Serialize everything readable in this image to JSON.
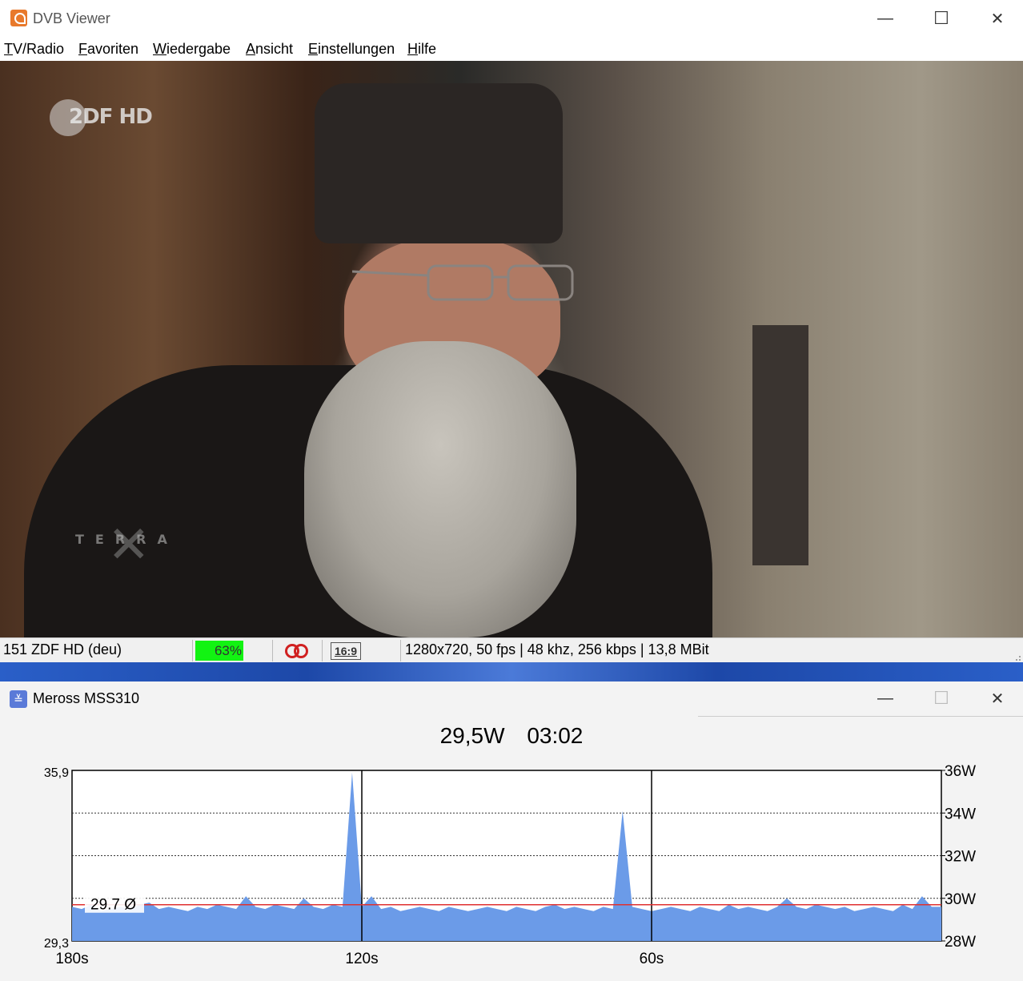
{
  "dvb_window": {
    "title": "DVB Viewer",
    "controls": {
      "minimize": "—",
      "maximize": "☐",
      "close": "✕"
    },
    "menu": [
      {
        "accel": "T",
        "rest": "V/Radio"
      },
      {
        "accel": "F",
        "rest": "avoriten"
      },
      {
        "accel": "W",
        "rest": "iedergabe"
      },
      {
        "accel": "A",
        "rest": "nsicht"
      },
      {
        "accel": "E",
        "rest": "instellungen"
      },
      {
        "accel": "H",
        "rest": "ilfe"
      }
    ],
    "video": {
      "channel_logo": "2DF HD",
      "watermark": "TERRA"
    },
    "status": {
      "channel": "151 ZDF HD (deu)",
      "signal_percent": 63,
      "signal_text": "63%",
      "aspect": "16:9",
      "stream_info": "1280x720, 50 fps | 48 khz, 256 kbps | 13,8 MBit",
      "signal_color": "#12f312"
    }
  },
  "meross_window": {
    "title": "Meross MSS310",
    "controls": {
      "minimize": "—",
      "maximize": "☐",
      "close": "✕"
    },
    "power": "29,5W",
    "elapsed": "03:02",
    "chart_data": {
      "type": "area",
      "x_labels": [
        "180s",
        "120s",
        "60s"
      ],
      "left_axis": {
        "max_label": "35,9",
        "min_label": "29,3"
      },
      "right_axis_labels": [
        "36W",
        "34W",
        "32W",
        "30W",
        "28W"
      ],
      "ylim": [
        28,
        36
      ],
      "xlim": [
        180,
        0
      ],
      "average": 29.7,
      "average_label": "29.7 Ø",
      "grid": true,
      "fill_color": "#6b9be8",
      "average_line_color": "#e03030",
      "series": [
        {
          "x": [
            180,
            178,
            176,
            174,
            172,
            170,
            168,
            166,
            164,
            162,
            160,
            158,
            156,
            154,
            152,
            150,
            148,
            146,
            144,
            142,
            140,
            138,
            136,
            134,
            132,
            130,
            128,
            126,
            124,
            122,
            120,
            118,
            116,
            114,
            112,
            110,
            108,
            106,
            104,
            102,
            100,
            98,
            96,
            94,
            92,
            90,
            88,
            86,
            84,
            82,
            80,
            78,
            76,
            74,
            72,
            70,
            68,
            66,
            64,
            62,
            60,
            58,
            56,
            54,
            52,
            50,
            48,
            46,
            44,
            42,
            40,
            38,
            36,
            34,
            32,
            30,
            28,
            26,
            24,
            22,
            20,
            18,
            16,
            14,
            12,
            10,
            8,
            6,
            4,
            2,
            0
          ],
          "values": [
            29.6,
            29.5,
            29.7,
            29.4,
            29.5,
            29.6,
            29.5,
            29.7,
            29.8,
            29.5,
            29.6,
            29.5,
            29.4,
            29.6,
            29.5,
            29.7,
            29.6,
            29.5,
            30.1,
            29.6,
            29.5,
            29.7,
            29.6,
            29.5,
            30.0,
            29.6,
            29.5,
            29.7,
            29.6,
            35.9,
            29.6,
            30.1,
            29.5,
            29.6,
            29.4,
            29.5,
            29.6,
            29.5,
            29.4,
            29.6,
            29.5,
            29.4,
            29.5,
            29.6,
            29.5,
            29.4,
            29.6,
            29.5,
            29.4,
            29.6,
            29.7,
            29.5,
            29.6,
            29.5,
            29.4,
            29.6,
            29.5,
            34.1,
            29.6,
            29.5,
            29.4,
            29.5,
            29.6,
            29.5,
            29.4,
            29.6,
            29.5,
            29.4,
            29.7,
            29.5,
            29.6,
            29.5,
            29.4,
            29.6,
            30.0,
            29.6,
            29.5,
            29.7,
            29.6,
            29.5,
            29.6,
            29.4,
            29.5,
            29.6,
            29.5,
            29.4,
            29.7,
            29.5,
            30.1,
            29.6,
            29.6
          ]
        }
      ]
    }
  }
}
